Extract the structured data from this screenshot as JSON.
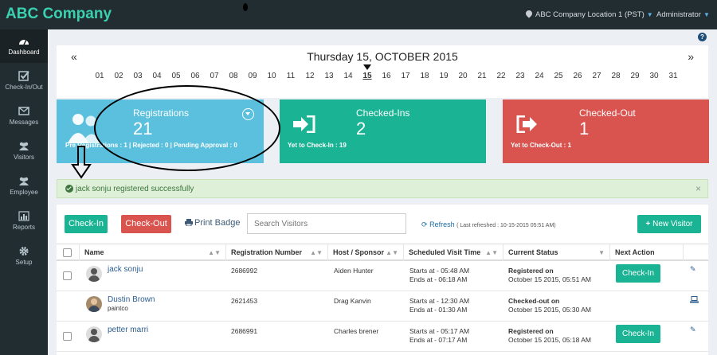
{
  "header": {
    "brand": "ABC Company",
    "location": "ABC Company Location 1 (PST)",
    "user": "Administrator"
  },
  "sidebar": {
    "items": [
      {
        "label": "Dashboard",
        "icon": "dashboard-icon"
      },
      {
        "label": "Check-In/Out",
        "icon": "checkbox-icon"
      },
      {
        "label": "Messages",
        "icon": "envelope-icon"
      },
      {
        "label": "Visitors",
        "icon": "users-icon"
      },
      {
        "label": "Employee",
        "icon": "users-icon"
      },
      {
        "label": "Reports",
        "icon": "bar-chart-icon"
      },
      {
        "label": "Setup",
        "icon": "gear-icon"
      }
    ]
  },
  "datebar": {
    "prev": "«",
    "next": "»",
    "title": "Thursday 15, OCTOBER 2015",
    "days": [
      "01",
      "02",
      "03",
      "04",
      "05",
      "06",
      "07",
      "08",
      "09",
      "10",
      "11",
      "12",
      "13",
      "14",
      "15",
      "16",
      "17",
      "18",
      "19",
      "20",
      "21",
      "22",
      "23",
      "24",
      "25",
      "26",
      "27",
      "28",
      "29",
      "30",
      "31"
    ],
    "selected_day": "15"
  },
  "cards": {
    "registrations": {
      "label": "Registrations",
      "count": "21",
      "sub": "Pre Registrations : 1 | Rejected : 0 | Pending Approval : 0"
    },
    "checked_ins": {
      "label": "Checked-Ins",
      "count": "2",
      "sub": "Yet to Check-In : 19"
    },
    "checked_out": {
      "label": "Checked-Out",
      "count": "1",
      "sub": "Yet to Check-Out : 1"
    }
  },
  "alert": {
    "message": "jack sonju registered successfully",
    "close": "×"
  },
  "toolbar": {
    "check_in": "Check-In",
    "check_out": "Check-Out",
    "print_badge": "Print Badge",
    "search_placeholder": "Search Visitors",
    "refresh": "Refresh",
    "last_refreshed": "( Last refreshed : 10-15-2015 05:51 AM)",
    "new_visitor": "New Visitor"
  },
  "table": {
    "headers": [
      "Name",
      "Registration Number",
      "Host / Sponsor",
      "Scheduled Visit Time",
      "Current Status",
      "Next Action"
    ],
    "rows": [
      {
        "name": "jack sonju",
        "company": "",
        "reg": "2686992",
        "host": "Aiden Hunter",
        "start": "Starts at - 05:48 AM",
        "end": "Ends at - 06:18 AM",
        "status": "Registered on",
        "status_date": "October 15 2015, 05:51 AM",
        "action": "Check-In",
        "has_checkbox": true
      },
      {
        "name": "Dustin Brown",
        "company": "paintco",
        "reg": "2621453",
        "host": "Drag Kanvin",
        "start": "Starts at - 12:30 AM",
        "end": "Ends at - 01:30 AM",
        "status": "Checked-out on",
        "status_date": "October 15 2015, 05:30 AM",
        "action": "",
        "has_checkbox": false
      },
      {
        "name": "petter marri",
        "company": "",
        "reg": "2686991",
        "host": "Charles brener",
        "start": "Starts at - 05:17 AM",
        "end": "Ends at - 07:17 AM",
        "status": "Registered on",
        "status_date": "October 15 2015, 05:18 AM",
        "action": "Check-In",
        "has_checkbox": true
      }
    ]
  },
  "colors": {
    "sidebar": "#222d32",
    "brand": "#3ad0b0",
    "registrations": "#5bc0de",
    "checked_ins": "#1ab394",
    "checked_out": "#d9534f",
    "alert_bg": "#dff0d8"
  }
}
